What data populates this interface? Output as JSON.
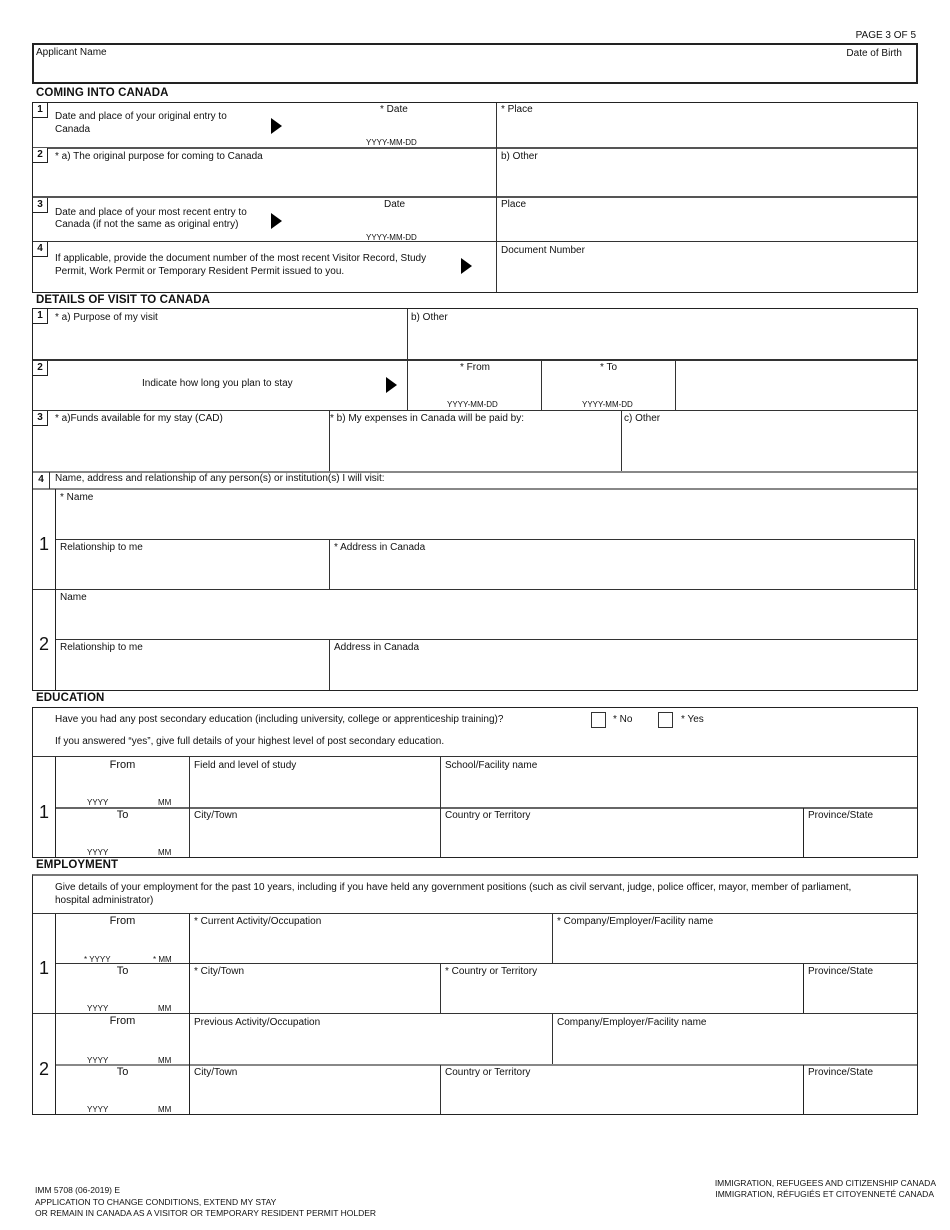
{
  "page_indicator": "PAGE 3 OF 5",
  "header": {
    "applicant_name_label": "Applicant Name",
    "date_of_birth_label": "Date of Birth"
  },
  "coming_into_canada": {
    "title": "COMING INTO CANADA",
    "q1": {
      "num": "1",
      "text_line1": "Date and place of your original entry to",
      "text_line2": "Canada",
      "date_label": "* Date",
      "date_format": "YYYY-MM-DD",
      "place_label": "* Place"
    },
    "q2": {
      "num": "2",
      "purpose_label": "* a) The original purpose for coming to Canada",
      "other_label": "b) Other"
    },
    "q3": {
      "num": "3",
      "text_line1": "Date and place of your most recent entry to",
      "text_line2": "Canada (if not the same as original entry)",
      "date_label": "Date",
      "date_format": "YYYY-MM-DD",
      "place_label": "Place"
    },
    "q4": {
      "num": "4",
      "text_line1": "If applicable, provide the document number of the most recent Visitor Record, Study",
      "text_line2": "Permit, Work Permit or Temporary Resident Permit issued to you.",
      "doc_label": "Document Number"
    }
  },
  "details_of_visit": {
    "title": "DETAILS OF VISIT TO CANADA",
    "q1": {
      "num": "1",
      "purpose_label": "* a) Purpose of my visit",
      "other_label": "b) Other"
    },
    "q2": {
      "num": "2",
      "text": "Indicate how long you plan to stay",
      "from_label": "* From",
      "to_label": "* To",
      "date_format": "YYYY-MM-DD"
    },
    "q3": {
      "num": "3",
      "funds_label": "* a)Funds available for my stay (CAD)",
      "paid_by_label": "* b) My expenses in Canada will be paid by:",
      "other_label": "c) Other"
    },
    "q4": {
      "num": "4",
      "text": "Name, address and relationship of any person(s) or institution(s) I will visit:",
      "persons": [
        {
          "index": "1",
          "name_label": "* Name",
          "relationship_label": "Relationship to me",
          "address_label": "* Address in Canada"
        },
        {
          "index": "2",
          "name_label": "Name",
          "relationship_label": "Relationship to me",
          "address_label": "Address in Canada"
        }
      ]
    }
  },
  "education": {
    "title": "EDUCATION",
    "question": "Have you had any post secondary education (including university, college or apprenticeship training)?",
    "no_label": "* No",
    "yes_label": "* Yes",
    "instruction": "If you answered “yes”, give full details of your highest level of post secondary education.",
    "entry": {
      "index": "1",
      "from_label": "From",
      "to_label": "To",
      "yyyy": "YYYY",
      "mm": "MM",
      "field_label": "Field and level of study",
      "school_label": "School/Facility name",
      "city_label": "City/Town",
      "country_label": "Country or Territory",
      "province_label": "Province/State"
    }
  },
  "employment": {
    "title": "EMPLOYMENT",
    "instruction_line1": "Give details of your employment for the past 10 years, including if you have held any government positions (such as civil servant, judge, police officer, mayor, member of parliament,",
    "instruction_line2": "hospital administrator)",
    "entries": [
      {
        "index": "1",
        "from_label": "From",
        "to_label": "To",
        "from_yyyy": "* YYYY",
        "from_mm": "* MM",
        "to_yyyy": "YYYY",
        "to_mm": "MM",
        "activity_label": "* Current Activity/Occupation",
        "company_label": "* Company/Employer/Facility name",
        "city_label": "* City/Town",
        "country_label": "* Country or Territory",
        "province_label": "Province/State"
      },
      {
        "index": "2",
        "from_label": "From",
        "to_label": "To",
        "from_yyyy": "YYYY",
        "from_mm": "MM",
        "to_yyyy": "YYYY",
        "to_mm": "MM",
        "activity_label": "Previous Activity/Occupation",
        "company_label": "Company/Employer/Facility name",
        "city_label": "City/Town",
        "country_label": "Country or Territory",
        "province_label": "Province/State"
      }
    ]
  },
  "footer": {
    "form_id": "IMM 5708 (06-2019) E",
    "form_title_line1": "APPLICATION TO CHANGE CONDITIONS, EXTEND MY STAY",
    "form_title_line2": "OR REMAIN IN CANADA AS A VISITOR OR TEMPORARY RESIDENT PERMIT HOLDER",
    "dept_en": "IMMIGRATION, REFUGEES AND CITIZENSHIP CANADA",
    "dept_fr": "IMMIGRATION, RÉFUGIÉS ET CITOYENNETÉ CANADA"
  }
}
